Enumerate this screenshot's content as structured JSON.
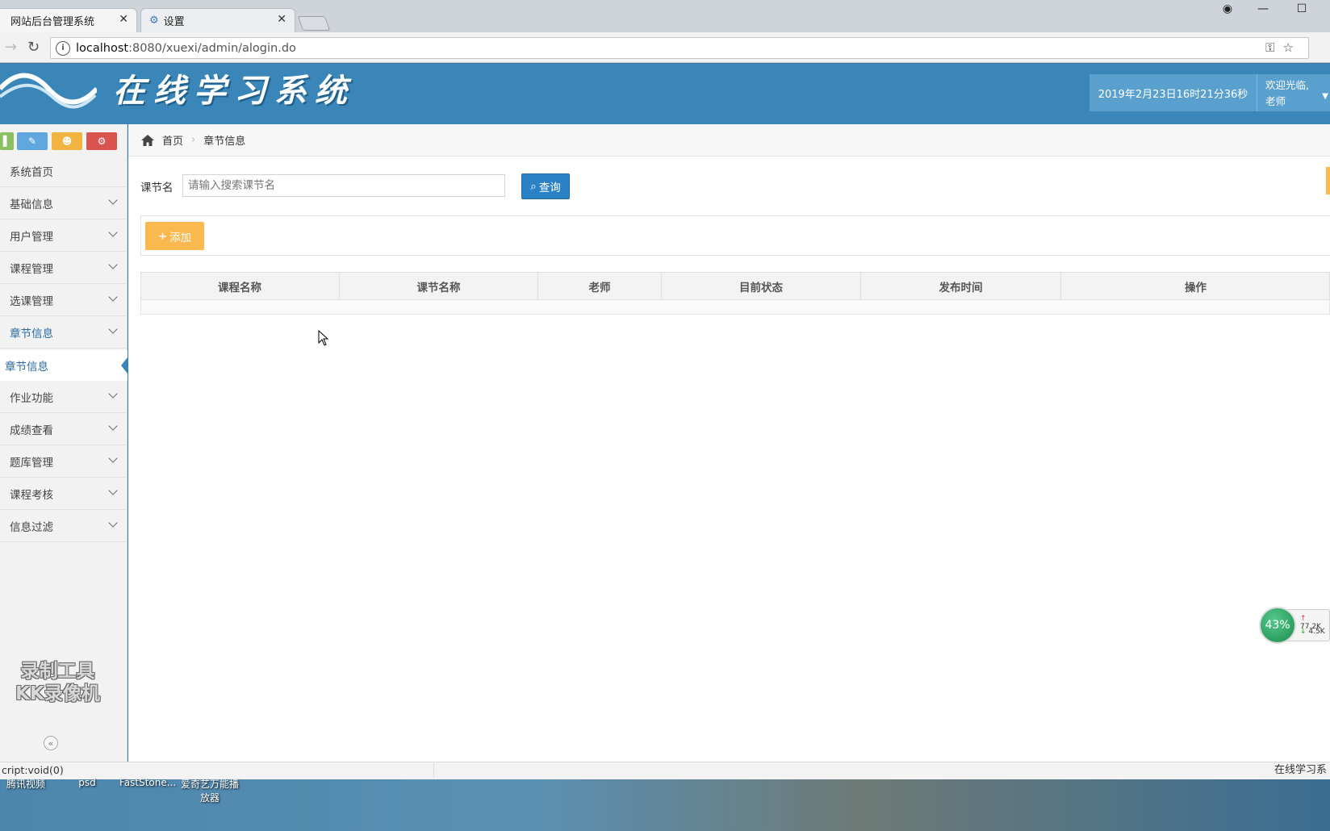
{
  "browser": {
    "tabs": [
      {
        "title": "网站后台管理系统",
        "active": true
      },
      {
        "title": "设置",
        "active": false
      }
    ],
    "url_host": "localhost",
    "url_path": ":8080/xuexi/admin/alogin.do"
  },
  "header": {
    "app_title": "在线学习系统",
    "datetime": "2019年2月23日16时21分36秒",
    "welcome": "欢迎光临,",
    "user_role": "老师"
  },
  "sidebar": {
    "shortcut_colors": [
      "#8bbf64",
      "#5fa7de",
      "#f2b441",
      "#d9534f"
    ],
    "items": [
      {
        "label": "系统首页",
        "has_children": false
      },
      {
        "label": "基础信息",
        "has_children": true
      },
      {
        "label": "用户管理",
        "has_children": true
      },
      {
        "label": "课程管理",
        "has_children": true
      },
      {
        "label": "选课管理",
        "has_children": true
      },
      {
        "label": "章节信息",
        "has_children": true,
        "open": true
      },
      {
        "label": "作业功能",
        "has_children": true
      },
      {
        "label": "成绩查看",
        "has_children": true
      },
      {
        "label": "题库管理",
        "has_children": true
      },
      {
        "label": "课程考核",
        "has_children": true
      },
      {
        "label": "信息过滤",
        "has_children": true
      }
    ],
    "active_subitem": "章节信息",
    "watermark_line1": "录制工具",
    "watermark_line2": "KK录像机"
  },
  "breadcrumb": {
    "home": "首页",
    "current": "章节信息"
  },
  "search": {
    "label": "课节名",
    "placeholder": "请输入搜索课节名",
    "button": "查询"
  },
  "toolbar": {
    "add_label": "添加"
  },
  "table": {
    "columns": [
      "课程名称",
      "课节名称",
      "老师",
      "目前状态",
      "发布时间",
      "操作"
    ],
    "rows": []
  },
  "statusbar": {
    "left": "cript:void(0)",
    "right": "在线学习系"
  },
  "desktop": {
    "icons": [
      "腾讯视频",
      "psd",
      "FastStone...",
      "爱奇艺万能播放器"
    ]
  },
  "speed_widget": {
    "percent": "43%",
    "upload": "77.2K",
    "download": "4.5K"
  },
  "colors": {
    "header_bg": "#3a86b9",
    "query_button": "#2a81c6",
    "add_button": "#f9b94f",
    "active_menu": "#2a6ba1"
  }
}
